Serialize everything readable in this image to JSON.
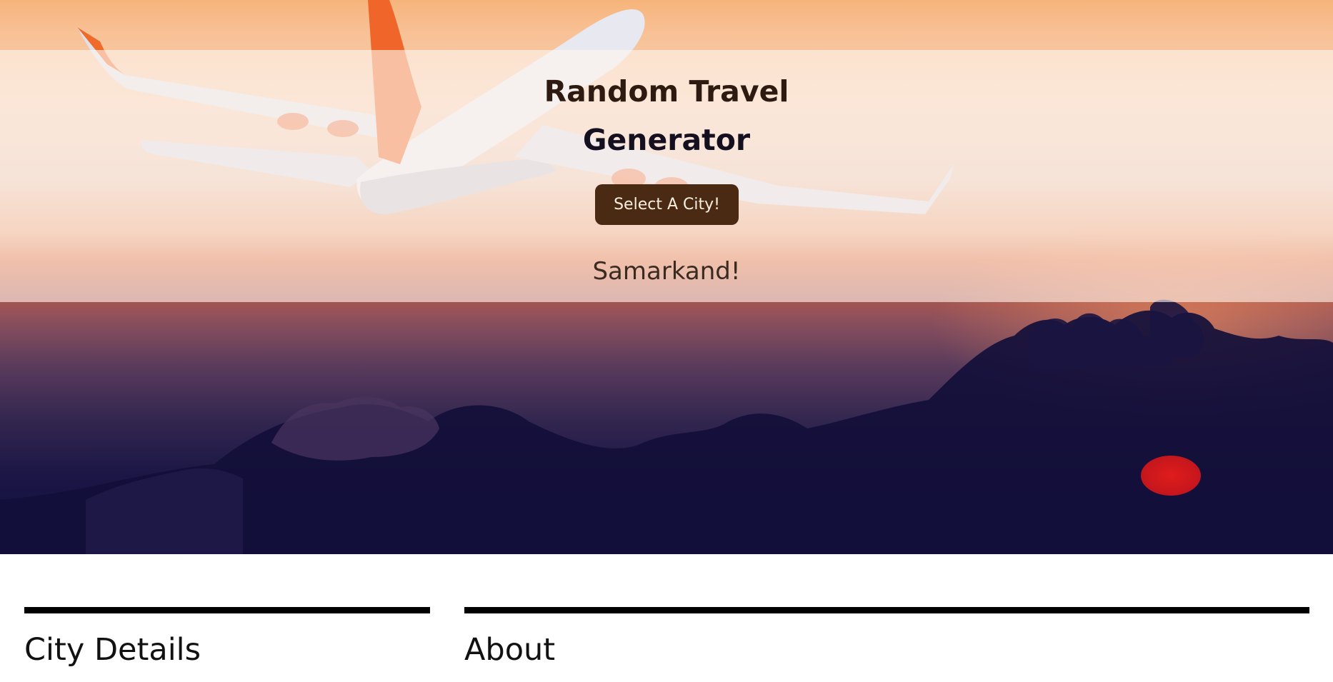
{
  "hero": {
    "title_line1": "Random Travel",
    "title_line2": "Generator",
    "select_button_label": "Select A City!",
    "result_text": "Samarkand!"
  },
  "sections": {
    "city_details_heading": "City Details",
    "about_heading": "About"
  },
  "colors": {
    "button_bg": "#4a2a12",
    "button_text": "#fbeee0",
    "rule": "#000000",
    "title_text": "#2e1a10"
  }
}
